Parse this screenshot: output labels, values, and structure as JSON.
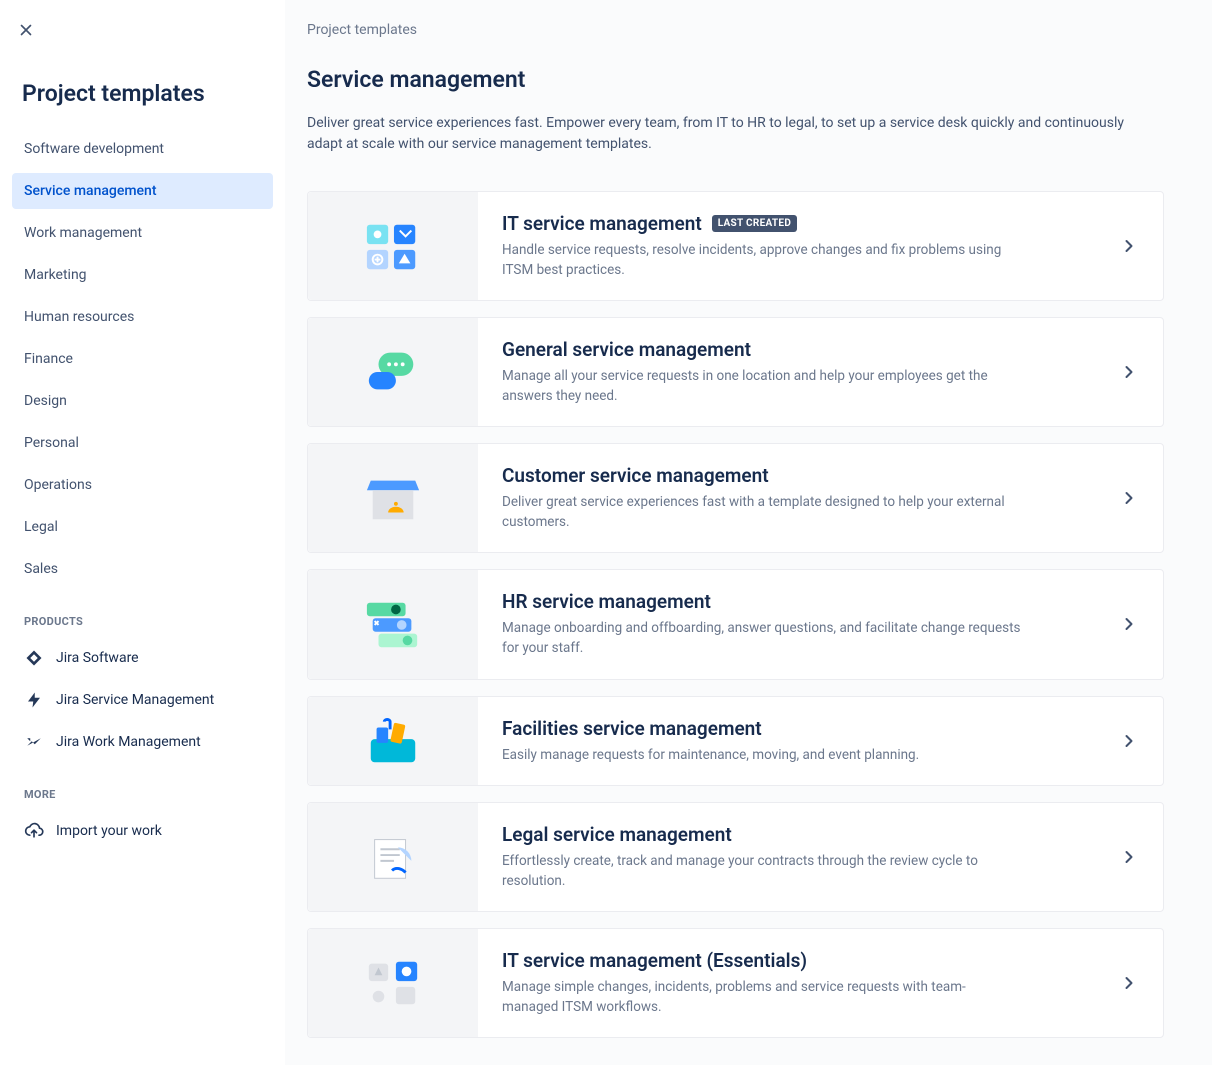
{
  "sidebar": {
    "title": "Project templates",
    "categories": [
      "Software development",
      "Service management",
      "Work management",
      "Marketing",
      "Human resources",
      "Finance",
      "Design",
      "Personal",
      "Operations",
      "Legal",
      "Sales"
    ],
    "active_index": 1,
    "products_label": "Products",
    "products": [
      "Jira Software",
      "Jira Service Management",
      "Jira Work Management"
    ],
    "more_label": "More",
    "import_label": "Import your work"
  },
  "main": {
    "breadcrumb": "Project templates",
    "title": "Service management",
    "description": "Deliver great service experiences fast. Empower every team, from IT to HR to legal, to set up a service desk quickly and continuously adapt at scale with our service management templates.",
    "badge_last_created": "LAST CREATED",
    "templates": [
      {
        "title": "IT service management",
        "badge": true,
        "description": "Handle service requests, resolve incidents, approve changes and fix problems using ITSM best practices."
      },
      {
        "title": "General service management",
        "badge": false,
        "description": "Manage all your service requests in one location and help your employees get the answers they need."
      },
      {
        "title": "Customer service management",
        "badge": false,
        "description": "Deliver great service experiences fast with a template designed to help your external customers."
      },
      {
        "title": "HR service management",
        "badge": false,
        "description": "Manage onboarding and offboarding, answer questions, and facilitate change requests for your staff."
      },
      {
        "title": "Facilities service management",
        "badge": false,
        "description": "Easily manage requests for maintenance, moving, and event planning."
      },
      {
        "title": "Legal service management",
        "badge": false,
        "description": "Effortlessly create, track and manage your contracts through the review cycle to resolution."
      },
      {
        "title": "IT service management (Essentials)",
        "badge": false,
        "description": "Manage simple changes, incidents, problems and service requests with team-managed ITSM workflows."
      }
    ]
  }
}
